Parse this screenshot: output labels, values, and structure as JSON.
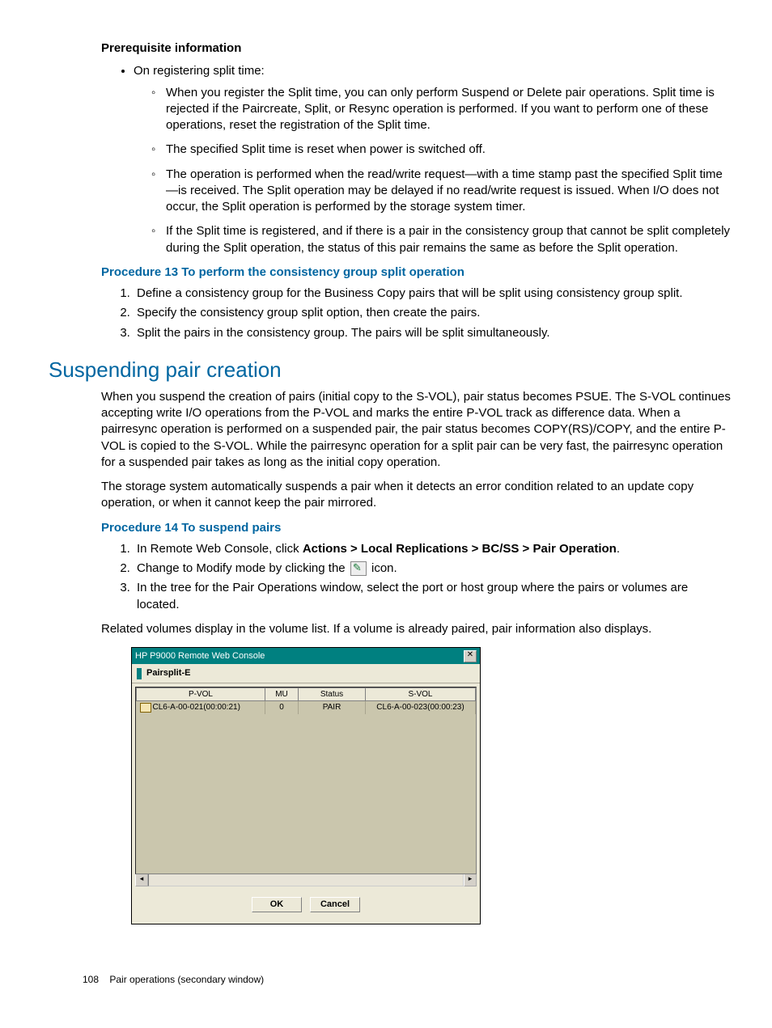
{
  "prereq": {
    "heading": "Prerequisite information",
    "top_bullet": "On registering split time:",
    "sub": [
      "When you register the Split time, you can only perform Suspend or Delete pair operations. Split time is rejected if the Paircreate, Split, or Resync operation is performed. If you want to perform one of these operations, reset the registration of the Split time.",
      "The specified Split time is reset when power is switched off.",
      "The operation is performed when the read/write request—with a time stamp past the specified Split time—is received. The Split operation may be delayed if no read/write request is issued. When I/O does not occur, the Split operation is performed by the storage system timer.",
      "If the Split time is registered, and if there is a pair in the consistency group that cannot be split completely during the Split operation, the status of this pair remains the same as before the Split operation."
    ]
  },
  "proc13": {
    "heading": "Procedure 13 To perform the consistency group split operation",
    "steps": [
      "Define a consistency group for the Business Copy pairs that will be split using consistency group split.",
      "Specify the consistency group split option, then create the pairs.",
      "Split the pairs in the consistency group. The pairs will be split simultaneously."
    ]
  },
  "section": {
    "heading": "Suspending pair creation",
    "p1": "When you suspend the creation of pairs (initial copy to the S-VOL), pair status becomes PSUE. The S-VOL continues accepting write I/O operations from the P-VOL and marks the entire P-VOL track as difference data. When a pairresync operation is performed on a suspended pair, the pair status becomes COPY(RS)/COPY, and the entire P-VOL is copied to the S-VOL. While the pairresync operation for a split pair can be very fast, the pairresync operation for a suspended pair takes as long as the initial copy operation.",
    "p2": "The storage system automatically suspends a pair when it detects an error condition related to an update copy operation, or when it cannot keep the pair mirrored."
  },
  "proc14": {
    "heading": "Procedure 14 To suspend pairs",
    "step1_pre": "In Remote Web Console, click ",
    "step1_bold": "Actions > Local Replications > BC/SS > Pair Operation",
    "step1_post": ".",
    "step2_pre": "Change to Modify mode by clicking the ",
    "step2_post": " icon.",
    "step3": "In the tree for the Pair Operations window, select the port or host group where the pairs or volumes are located.",
    "related": "Related volumes display in the volume list. If a volume is already paired, pair information also displays."
  },
  "dialog": {
    "title": "HP P9000 Remote Web Console",
    "subtitle": "Pairsplit-E",
    "cols": {
      "c1": "P-VOL",
      "c2": "MU",
      "c3": "Status",
      "c4": "S-VOL"
    },
    "row": {
      "pvol": "CL6-A-00-021(00:00:21)",
      "mu": "0",
      "status": "PAIR",
      "svol": "CL6-A-00-023(00:00:23)"
    },
    "ok": "OK",
    "cancel": "Cancel"
  },
  "footer": {
    "page": "108",
    "title": "Pair operations (secondary window)"
  }
}
